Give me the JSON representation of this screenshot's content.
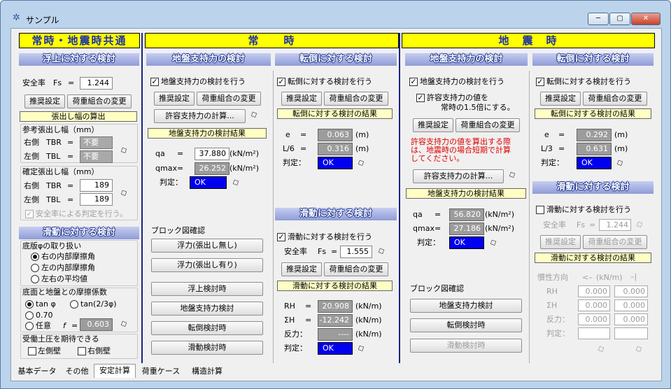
{
  "window": {
    "title": "サンプル",
    "min": "─",
    "max": "▢",
    "close": "✕"
  },
  "sections": {
    "common": "常時・地震時共通",
    "normal": "常　　時",
    "quake": "地　震　時"
  },
  "c1": {
    "uplift": {
      "title": "浮上に対する検討",
      "sf_label": "安全率",
      "sf_sym": "Fs",
      "eq": "=",
      "sf_value": "1.244",
      "btn_rec": "推奨設定",
      "btn_load": "荷重組合の変更"
    },
    "overhang": {
      "title": "張出し幅の算出",
      "ref_label": "参考張出し幅（mm）",
      "right": "右側",
      "left": "左側",
      "tbr": "TBR",
      "tbl": "TBL",
      "eq": "=",
      "rec": "不要",
      "fix_label": "確定張出し幅（mm）",
      "right_val": "189",
      "left_val": "189",
      "sf_judge": "安全率による判定を行う。"
    },
    "sliding": {
      "title": "滑動に対する検討",
      "slab_label": "底版φの取り扱い",
      "opt1": "右の内部摩擦角",
      "opt2": "左の内部摩擦角",
      "opt3": "左右の平均値",
      "fric_label": "底面と地盤との摩擦係数",
      "fo1": "tan φ",
      "fo2": "tan(2/3φ)",
      "fo3": "0.70",
      "fo4": "任意",
      "f_sym": "f",
      "f_eq": "=",
      "f_value": "0.603",
      "press_label": "受働土圧を期待できる",
      "left_wall": "左側壁",
      "right_wall": "右側壁"
    }
  },
  "n1": {
    "title": "地盤支持力の検討",
    "check": "地盤支持力の検討を行う",
    "btn_rec": "推奨設定",
    "btn_load": "荷重組合の変更",
    "btn_calc": "許容支持力の計算...",
    "result": "地盤支持力の検討結果",
    "qa": "qa",
    "qmax": "qmax",
    "eq": "=",
    "qa_val": "37.880",
    "qmax_val": "26.252",
    "unit": "(kN/m²)",
    "judge": "判定：",
    "ok": "OK",
    "block_label": "ブロック図確認",
    "b1": "浮力(張出し無し)",
    "b2": "浮力(張出し有り)",
    "b3": "浮上検討時",
    "b4": "地盤支持力検討",
    "b5": "転倒検討時",
    "b6": "滑動検討時"
  },
  "n2": {
    "title": "転倒に対する検討",
    "check": "転倒に対する検討を行う",
    "btn_rec": "推奨設定",
    "btn_load": "荷重組合の変更",
    "result": "転倒に対する検討の結果",
    "e": "e",
    "l6": "L/6",
    "eq": "=",
    "e_val": "0.063",
    "l6_val": "0.316",
    "unit": "(m)",
    "judge": "判定：",
    "ok": "OK"
  },
  "n3": {
    "title": "滑動に対する検討",
    "check": "滑動に対する検討を行う",
    "sf_label": "安全率",
    "sf_sym": "Fs",
    "eq": "=",
    "sf_value": "1.555",
    "btn_rec": "推奨設定",
    "btn_load": "荷重組合の変更",
    "result": "滑動に対する検討の結果",
    "rh": "RH",
    "sh": "ΣH",
    "react": "反力：",
    "rh_val": "20.908",
    "sh_val": "-12.242",
    "react_val": "----",
    "unit": "(kN/m)",
    "judge": "判定：",
    "ok": "OK"
  },
  "q1": {
    "title": "地盤支持力の検討",
    "check": "地盤支持力の検討を行う",
    "check2a": "許容支持力の値を",
    "check2b": "常時の1.5倍にする。",
    "btn_rec": "推奨設定",
    "btn_load": "荷重組合の変更",
    "note1": "許容支持力の値を算出する際",
    "note2": "は、地震時の場合短期で計算",
    "note3": "してください。",
    "btn_calc": "許容支持力の計算...",
    "result": "地盤支持力の検討結果",
    "qa": "qa",
    "qmax": "qmax",
    "eq": "=",
    "qa_val": "56.820",
    "qmax_val": "27.186",
    "unit": "(kN/m²)",
    "judge": "判定：",
    "ok": "OK",
    "block_label": "ブロック図確認",
    "b1": "地盤支持力検討",
    "b2": "転倒検討時",
    "b3": "滑動検討時"
  },
  "q2": {
    "title": "転倒に対する検討",
    "check": "転倒に対する検討を行う",
    "btn_rec": "推奨設定",
    "btn_load": "荷重組合の変更",
    "result": "転倒に対する検討の結果",
    "e": "e",
    "l3": "L/3",
    "eq": "=",
    "e_val": "0.292",
    "l3_val": "0.631",
    "unit": "(m)",
    "judge": "判定：",
    "ok": "OK"
  },
  "q3": {
    "title": "滑動に対する検討",
    "check": "滑動に対する検討を行う",
    "sf_label": "安全率",
    "sf_sym": "Fs",
    "eq": "=",
    "sf_value": "1.244",
    "btn_rec": "推奨設定",
    "btn_load": "荷重組合の変更",
    "result": "滑動に対する検討の結果",
    "dir_label": "慣性方向",
    "dir_unit": "(kN/m)",
    "rh": "RH",
    "sh": "ΣH",
    "react": "反力：",
    "judge": "判定：",
    "v1": "0.000",
    "v2": "0.000"
  },
  "tabs": [
    "基本データ",
    "その他",
    "安定計算",
    "荷重ケース",
    "構造計算"
  ]
}
